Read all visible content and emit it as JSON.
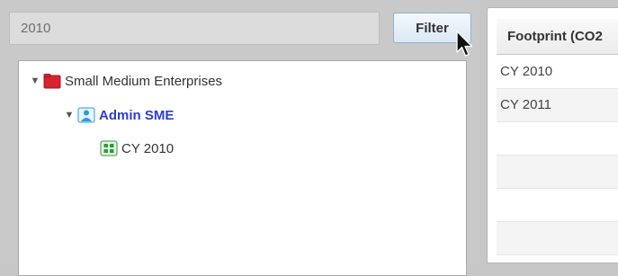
{
  "filter": {
    "input_value": "2010",
    "button_label": "Filter"
  },
  "tree": {
    "nodes": [
      {
        "label": "Small Medium Enterprises",
        "icon": "folder-icon",
        "expanded": true,
        "color": "#d9232e"
      },
      {
        "label": "Admin SME",
        "icon": "user-icon",
        "expanded": true,
        "selected": true,
        "color": "#2b9be0"
      },
      {
        "label": "CY 2010",
        "icon": "grid-icon",
        "color": "#2a9d3a"
      }
    ]
  },
  "grid": {
    "column_header": "Footprint (CO2",
    "rows": [
      "CY 2010",
      "CY 2011",
      "",
      "",
      "",
      "",
      ""
    ]
  },
  "colors": {
    "selected_text": "#2b3fd0",
    "button_border": "#8fb2d1"
  }
}
